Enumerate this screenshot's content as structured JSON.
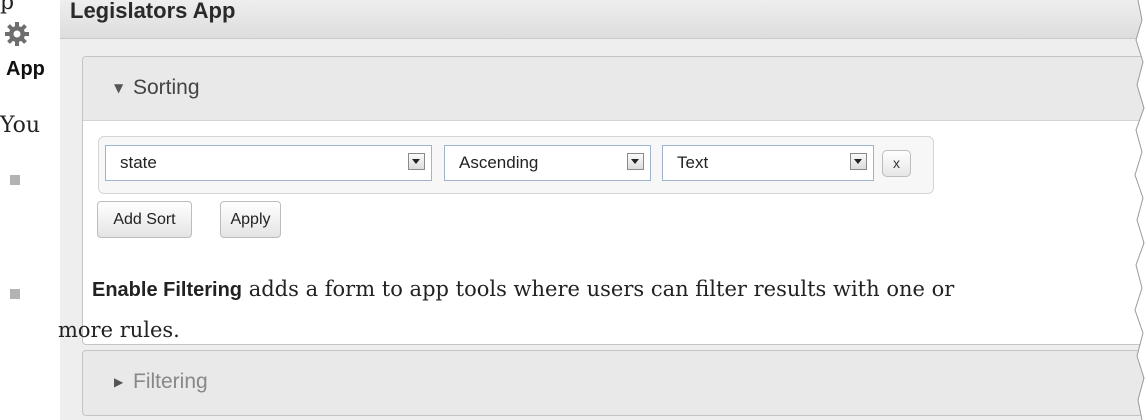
{
  "doc": {
    "top_fragment": "p",
    "app_label": "App",
    "you_text": "You",
    "filter_strong": "Enable Filtering",
    "filter_rest_line1": " adds a form to app tools where users can filter results with one or",
    "filter_line2": "more rules."
  },
  "window": {
    "title": "Legislators App"
  },
  "sorting": {
    "header": "Sorting",
    "rows": [
      {
        "field": "state",
        "direction": "Ascending",
        "type": "Text",
        "remove_label": "x"
      }
    ],
    "add_sort_label": "Add Sort",
    "apply_label": "Apply"
  },
  "filtering": {
    "header": "Filtering"
  },
  "colors": {
    "accordion_header_bg": "#e9e9e9",
    "select_border": "#9fb4cf",
    "bullet": "#b3b3b3"
  },
  "icons": {
    "settings": "gear-icon",
    "expanded": "triangle-down-icon",
    "collapsed": "triangle-right-icon",
    "dropdown": "dropdown-arrow-icon"
  }
}
